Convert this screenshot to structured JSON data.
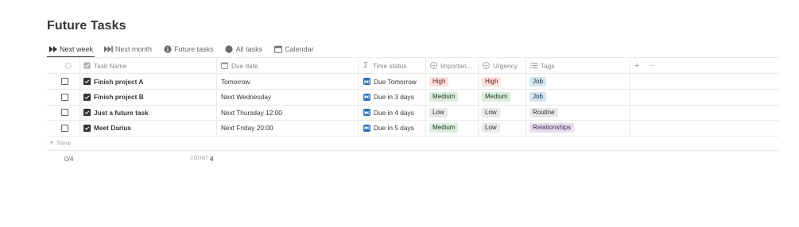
{
  "page": {
    "title": "Future Tasks"
  },
  "tabs": [
    {
      "label": "Next week",
      "icon": "fast-forward-icon",
      "active": true
    },
    {
      "label": "Next month",
      "icon": "skip-forward-icon"
    },
    {
      "label": "Future tasks",
      "icon": "info-icon"
    },
    {
      "label": "All tasks",
      "icon": "circle-icon"
    },
    {
      "label": "Calendar",
      "icon": "calendar-icon"
    }
  ],
  "columns": {
    "done": "",
    "task_name": "Task Name",
    "due_date": "Due date",
    "time_status": "Time status",
    "importance": "Importan...",
    "urgency": "Urgency",
    "tags": "Tags"
  },
  "tasks": [
    {
      "name": "Finish project A",
      "due": "Tomorrow",
      "status": "Due Tomorrow",
      "importance": "High",
      "urgency": "High",
      "tag": "Job"
    },
    {
      "name": "Finish project B",
      "due": "Next Wednesday",
      "status": "Due in 3 days",
      "importance": "Medium",
      "urgency": "Medium",
      "tag": "Job"
    },
    {
      "name": "Just a future task",
      "due": "Next Thursday 12:00",
      "status": "Due in 4 days",
      "importance": "Low",
      "urgency": "Low",
      "tag": "Routine"
    },
    {
      "name": "Meet Darius",
      "due": "Next Friday 20:00",
      "status": "Due in 5 days",
      "importance": "Medium",
      "urgency": "Low",
      "tag": "Relationships"
    }
  ],
  "new_row": {
    "plus": "+",
    "label": "New"
  },
  "footer": {
    "progress": "0/4",
    "count_label": "COUNT",
    "count_value": "4"
  },
  "colors": {
    "High": {
      "bg": "#ffe2dd",
      "fg": "#5d1715"
    },
    "Medium": {
      "bg": "#dbeddb",
      "fg": "#1c3829"
    },
    "Low": {
      "bg": "#e9e9e7",
      "fg": "#32302c"
    },
    "Job": {
      "bg": "#d3e5ef",
      "fg": "#183347"
    },
    "Routine": {
      "bg": "#e9e9e7",
      "fg": "#32302c"
    },
    "Relationships": {
      "bg": "#e8deee",
      "fg": "#412454"
    },
    "status_icon": "#2e6fb2"
  }
}
